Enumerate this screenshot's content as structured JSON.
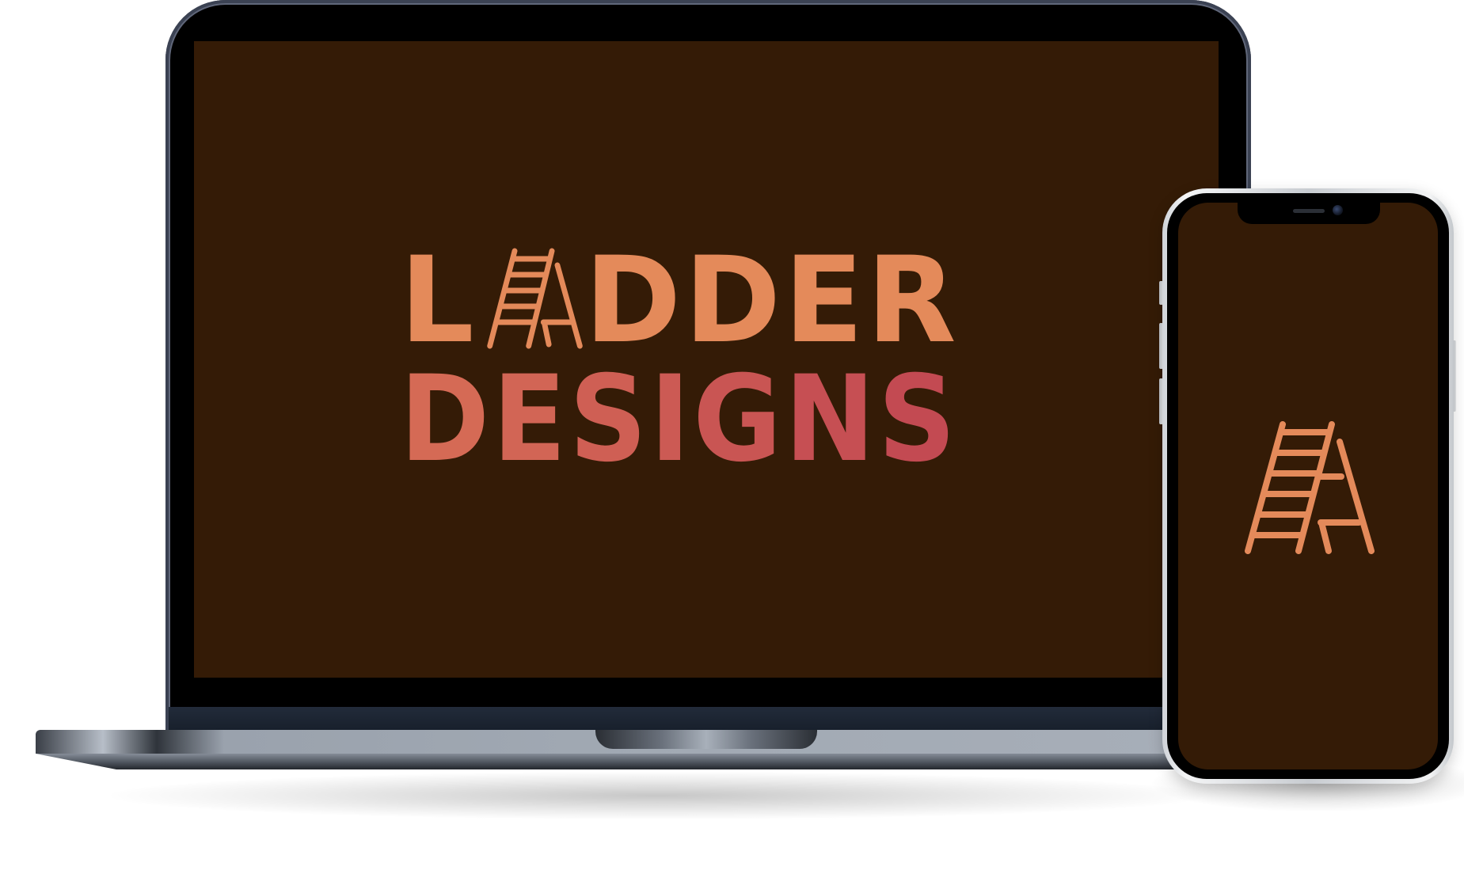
{
  "scene": {
    "description_type": "device mockup",
    "background_color": "#ffffff"
  },
  "laptop": {
    "screen_color": "#341b06",
    "logo": {
      "line1": {
        "first_letter": "L",
        "rest": "DDER"
      },
      "line2": "DESIGNS",
      "colors": {
        "line1": "#e48a5a",
        "line2_start": "#d56a55",
        "line2_end": "#c34a52"
      },
      "icon": "ladder-icon"
    }
  },
  "phone": {
    "screen_color": "#341b06",
    "logo_icon": "ladder-icon",
    "icon_color": "#e48a5a"
  }
}
